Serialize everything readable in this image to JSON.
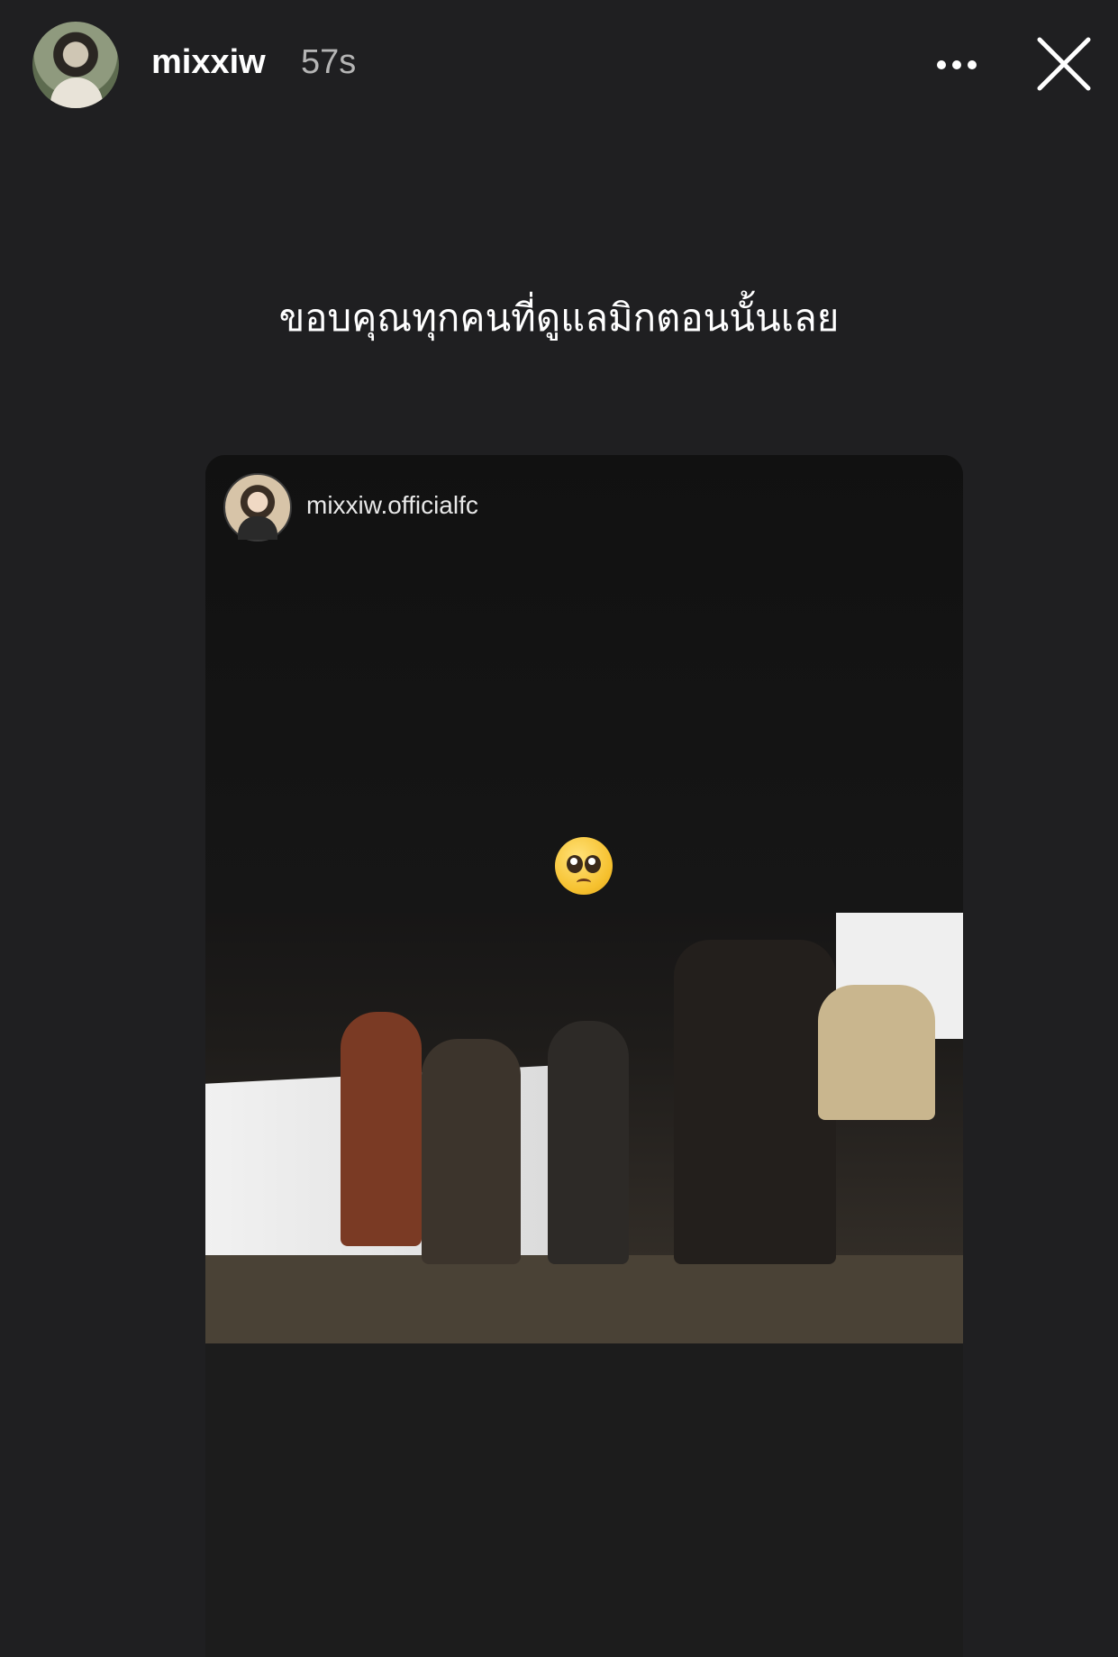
{
  "header": {
    "username": "mixxiw",
    "timestamp": "57s"
  },
  "caption": "ขอบคุณทุกคนที่ดูแลมิกตอนนั้นเลย",
  "shared_post": {
    "username": "mixxiw.officialfc",
    "emoji": "pleading-face"
  },
  "colors": {
    "background": "#1f1f21",
    "text": "#ffffff",
    "secondary_text": "#b5b5b5"
  }
}
